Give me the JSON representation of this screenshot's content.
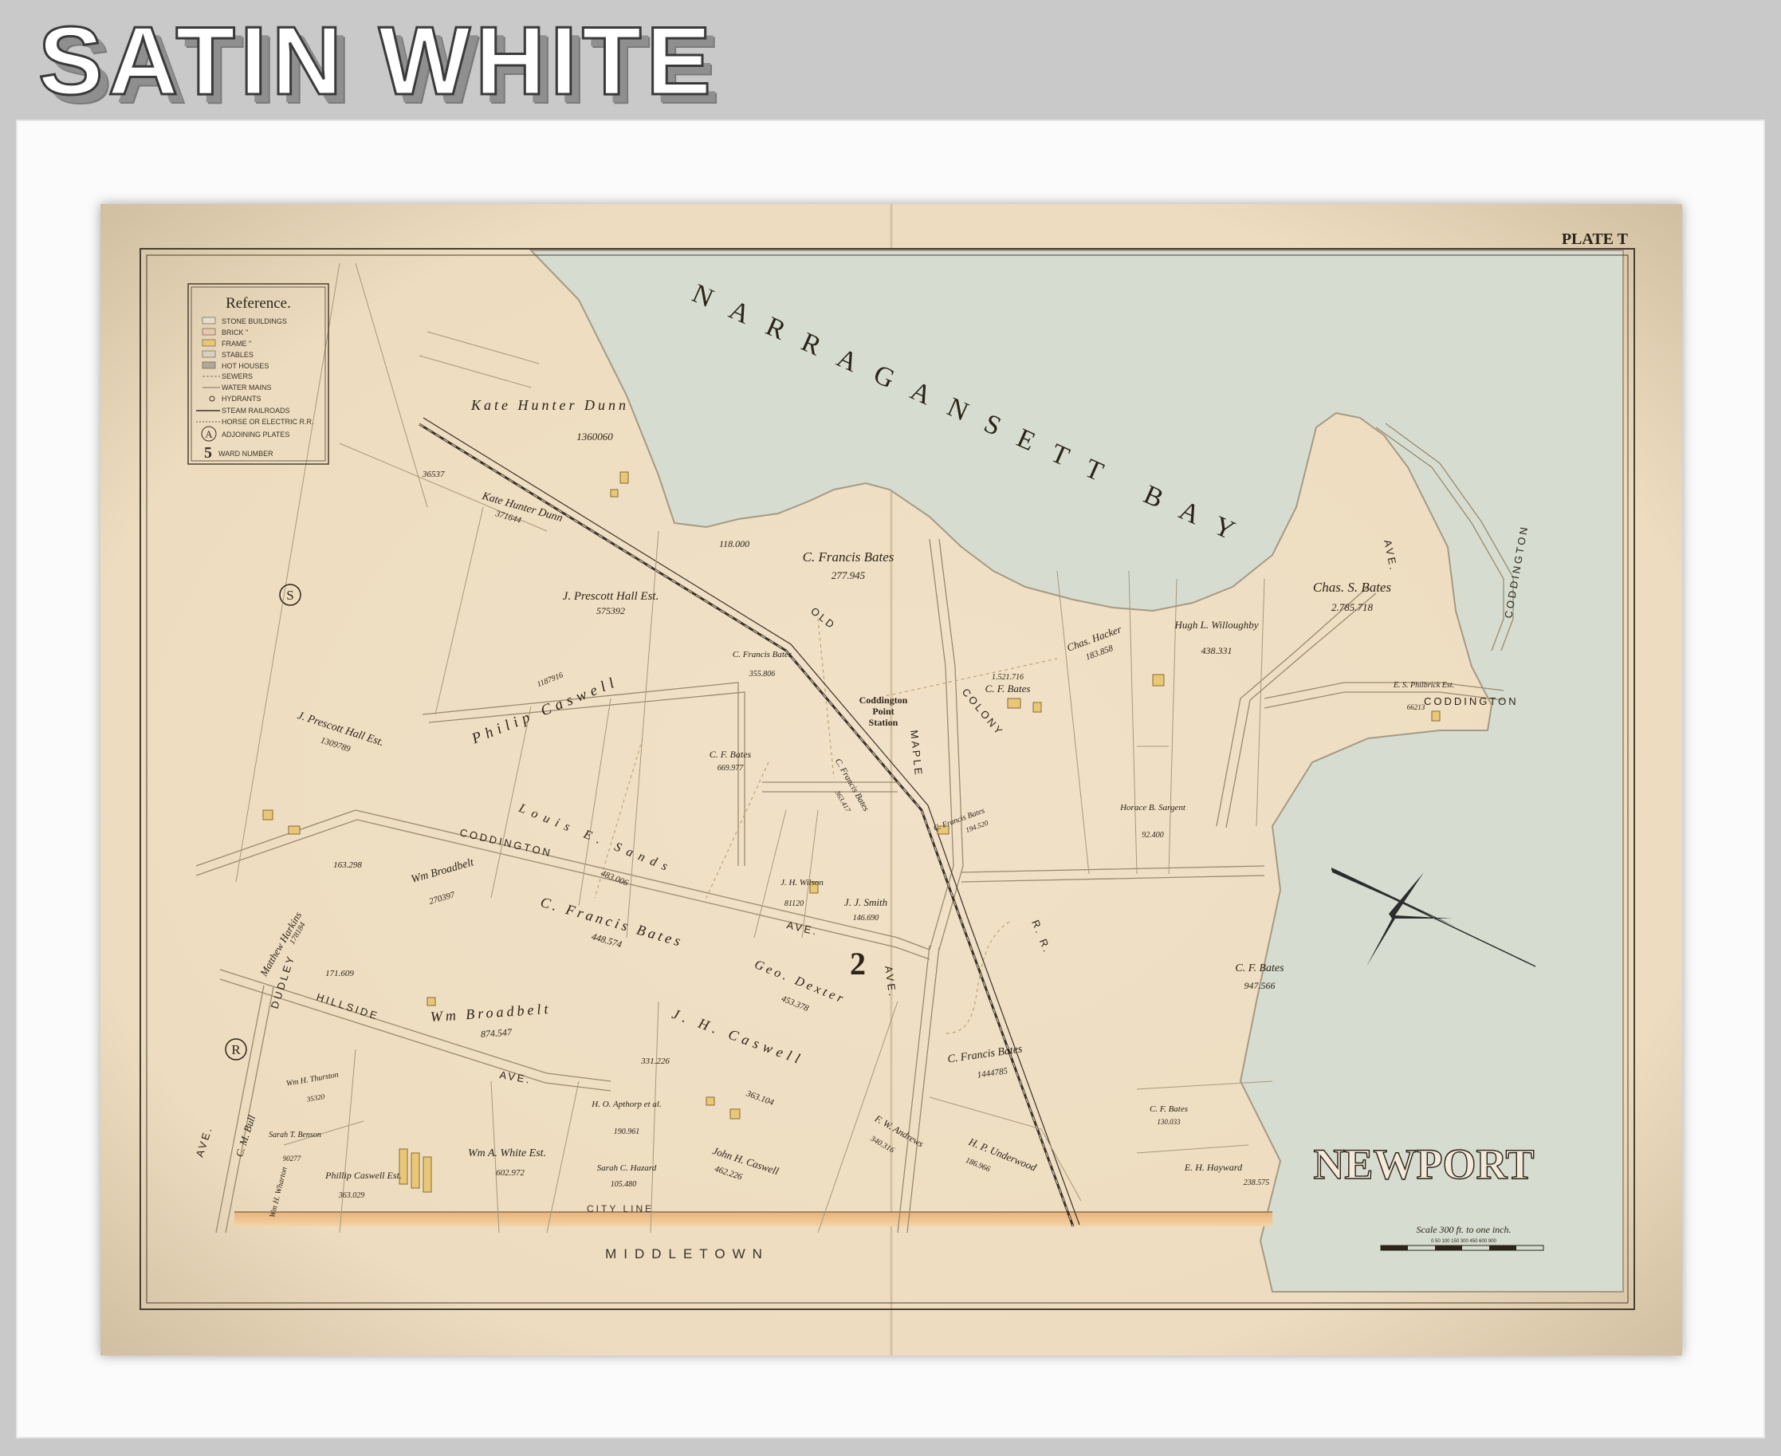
{
  "banner": {
    "title": "SATIN WHITE"
  },
  "plate": {
    "label": "PLATE T"
  },
  "title": "NEWPORT",
  "water": {
    "bay": "NARRAGANSETT BAY"
  },
  "town_below": "MIDDLETOWN",
  "city_line": "CITY LINE",
  "ward": "2",
  "legend": {
    "title": "Reference.",
    "items": [
      "STONE BUILDINGS",
      "BRICK  \"",
      "FRAME  \"",
      "STABLES",
      "HOT HOUSES",
      "SEWERS",
      "WATER MAINS",
      "HYDRANTS",
      "STEAM RAILROADS",
      "HORSE OR ELECTRIC R.R.",
      "ADJOINING PLATES",
      "WARD NUMBER"
    ],
    "circle_letter": "A",
    "ward_digit": "5"
  },
  "adjoining": [
    "S",
    "R"
  ],
  "streets": {
    "coddington_ave": "CODDINGTON",
    "ave_1": "AVE.",
    "hillside": "HILLSIDE",
    "ave_2": "AVE.",
    "dudley": "DUDLEY",
    "ave_3": "AVE.",
    "maple": "MAPLE",
    "ave_4": "AVE.",
    "old": "OLD",
    "colony": "COLONY",
    "rr": "R. R.",
    "coddington_east": "CODDINGTON",
    "ave_east": "AVE."
  },
  "station": {
    "line1": "Coddington",
    "line2": "Point",
    "line3": "Station"
  },
  "scale": {
    "label": "Scale 300 ft. to one inch.",
    "ticks": "0  50 100 150   300   450   600   900"
  },
  "owners": [
    {
      "name": "Kate Hunter Dunn",
      "value": "1360060"
    },
    {
      "name": "Kate Hunter Dunn",
      "value": "371644"
    },
    {
      "name": "",
      "value": "36537"
    },
    {
      "name": "",
      "value": "118.000"
    },
    {
      "name": "C. Francis Bates",
      "value": "277.945"
    },
    {
      "name": "J. Prescott Hall Est.",
      "value": "575392"
    },
    {
      "name": "Chas. S. Bates",
      "value": "2.785.718"
    },
    {
      "name": "Chas. Hacker",
      "value": "183.858"
    },
    {
      "name": "Hugh L. Willoughby",
      "value": "438.331"
    },
    {
      "name": "C. F. Bates",
      "value": "1.521.716"
    },
    {
      "name": "C. Francis Bates",
      "value": "355.806"
    },
    {
      "name": "Philip Caswell",
      "value": "1187916"
    },
    {
      "name": "J. Prescott Hall Est.",
      "value": "1309789"
    },
    {
      "name": "C. F. Bates",
      "value": "669.977"
    },
    {
      "name": "E. S. Philbrick Est.",
      "value": "66213"
    },
    {
      "name": "Horace B. Sargent",
      "value": "92.400"
    },
    {
      "name": "Louis E. Sands",
      "value": "483.006"
    },
    {
      "name": "C. Francis Bates",
      "value": "363.417"
    },
    {
      "name": "C. Francis Bates",
      "value": "194.520"
    },
    {
      "name": "Wm Broadbelt",
      "value": "270397"
    },
    {
      "name": "",
      "value": "163.298"
    },
    {
      "name": "C. Francis Bates",
      "value": "448.574"
    },
    {
      "name": "J. H. Wilson",
      "value": "81120"
    },
    {
      "name": "J. J. Smith",
      "value": "146.690"
    },
    {
      "name": "Matthew Harkins",
      "value": "178184"
    },
    {
      "name": "",
      "value": "171.609"
    },
    {
      "name": "Geo. Dexter",
      "value": "453.378"
    },
    {
      "name": "C. F. Bates",
      "value": "947.566"
    },
    {
      "name": "Wm Broadbelt",
      "value": "874.547"
    },
    {
      "name": "J. H. Caswell",
      "value": "363.104"
    },
    {
      "name": "",
      "value": "331.226"
    },
    {
      "name": "C. Francis Bates",
      "value": "1444785"
    },
    {
      "name": "Wm H. Thurston",
      "value": "35320"
    },
    {
      "name": "C. M. Bull",
      "value": ""
    },
    {
      "name": "Sarah T. Benson",
      "value": "90277"
    },
    {
      "name": "Phillip Caswell Est.",
      "value": "363.029"
    },
    {
      "name": "Wm A. White Est.",
      "value": "602.972"
    },
    {
      "name": "H. O. Apthorp et al.",
      "value": "190.961"
    },
    {
      "name": "John H. Caswell",
      "value": "462.226"
    },
    {
      "name": "Sarah C. Hazard",
      "value": "105.480"
    },
    {
      "name": "F. W. Andrews",
      "value": "340.316"
    },
    {
      "name": "H. P. Underwood",
      "value": "186.966"
    },
    {
      "name": "C. F. Bates",
      "value": "130.033"
    },
    {
      "name": "E. H. Hayward",
      "value": "238.575"
    },
    {
      "name": "Wm H. Wharton",
      "value": ""
    }
  ]
}
